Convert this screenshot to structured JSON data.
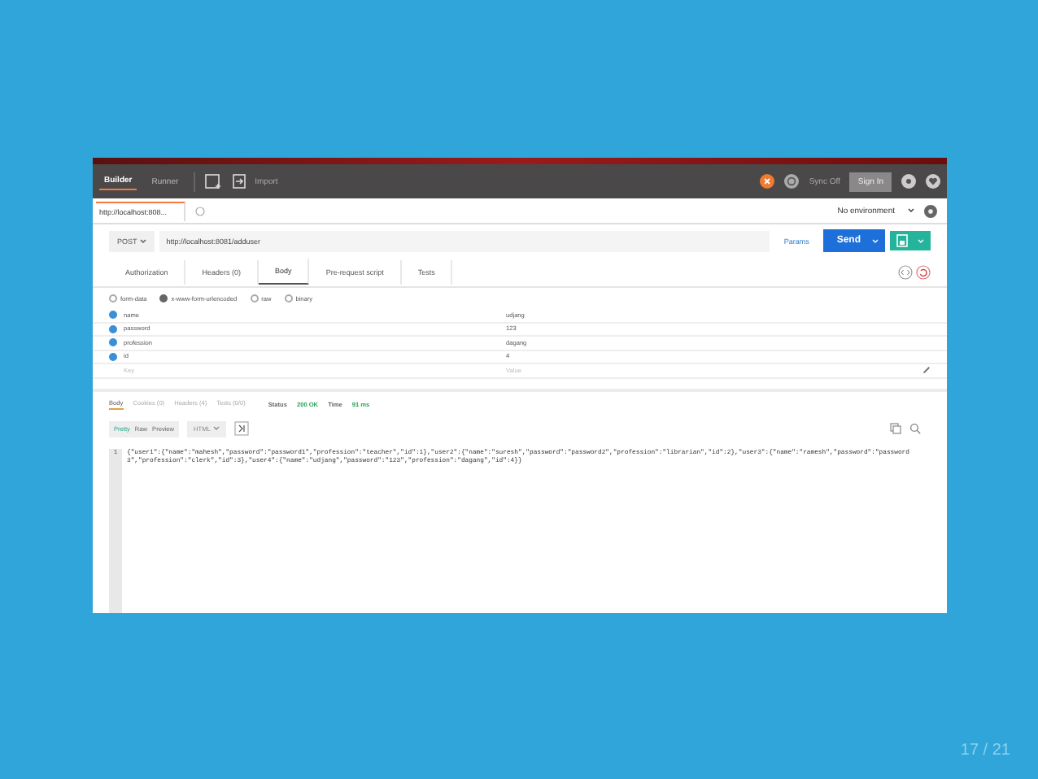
{
  "toolbar": {
    "tabs": [
      {
        "label": "Builder",
        "selected": true
      },
      {
        "label": "Runner",
        "selected": false
      }
    ],
    "import": "Import",
    "sync": "Sync Off",
    "sign_in": "Sign In"
  },
  "request_tabs": [
    {
      "label": "http://localhost:808...",
      "selected": true
    }
  ],
  "environment": "No environment",
  "request": {
    "method": "POST",
    "url": "http://localhost:8081/adduser",
    "params": "Params",
    "send": "Send"
  },
  "tabs": [
    {
      "label": "Authorization",
      "selected": false
    },
    {
      "label": "Headers (0)",
      "selected": false
    },
    {
      "label": "Body",
      "selected": true
    },
    {
      "label": "Pre-request script",
      "selected": false
    },
    {
      "label": "Tests",
      "selected": false
    }
  ],
  "body_modes": [
    {
      "label": "form-data",
      "selected": false
    },
    {
      "label": "x-www-form-urlencoded",
      "selected": true
    },
    {
      "label": "raw",
      "selected": false
    },
    {
      "label": "binary",
      "selected": false
    }
  ],
  "params": [
    {
      "key": "name",
      "value": "udjang",
      "checked": true
    },
    {
      "key": "password",
      "value": "123",
      "checked": true
    },
    {
      "key": "profession",
      "value": "dagang",
      "checked": true
    },
    {
      "key": "id",
      "value": "4",
      "checked": true
    }
  ],
  "new_param": {
    "key_placeholder": "Key",
    "value_placeholder": "Value"
  },
  "response": {
    "tabs": [
      {
        "label": "Body",
        "selected": true
      },
      {
        "label": "Cookies (0)",
        "selected": false
      },
      {
        "label": "Headers (4)",
        "selected": false
      },
      {
        "label": "Tests (0/0)",
        "selected": false
      }
    ],
    "status_label": "Status",
    "status": "200 OK",
    "time_label": "Time",
    "time": "91 ms",
    "views": [
      {
        "label": "Pretty",
        "selected": true
      },
      {
        "label": "Raw",
        "selected": false
      },
      {
        "label": "Preview",
        "selected": false
      }
    ],
    "format": "HTML",
    "line_numbers": [
      "1"
    ],
    "body": "{\"user1\":{\"name\":\"mahesh\",\"password\":\"password1\",\"profession\":\"teacher\",\"id\":1},\"user2\":{\"name\":\"suresh\",\"password\":\"password2\",\"profession\":\"librarian\",\"id\":2},\"user3\":{\"name\":\"ramesh\",\"password\":\"password3\",\"profession\":\"clerk\",\"id\":3},\"user4\":{\"name\":\"udjang\",\"password\":\"123\",\"profession\":\"dagang\",\"id\":4}}"
  },
  "page_counter": "17 / 21"
}
